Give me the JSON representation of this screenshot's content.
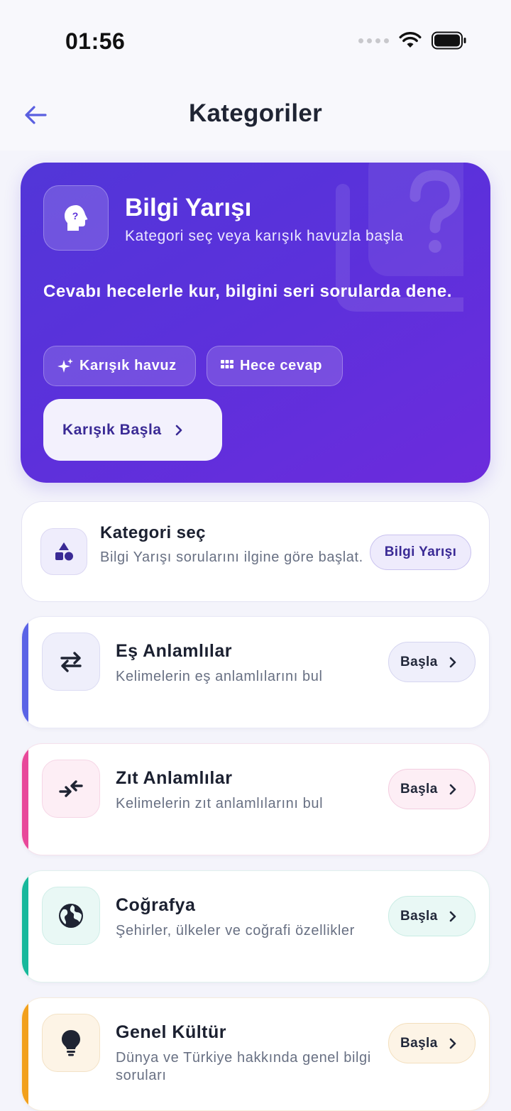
{
  "status_bar": {
    "time": "01:56"
  },
  "header": {
    "title": "Kategoriler"
  },
  "hero": {
    "title": "Bilgi Yarışı",
    "subtitle": "Kategori seç veya karışık havuzla başla",
    "description": "Cevabı hecelerle kur, bilgini seri sorularda dene.",
    "chips": [
      "Karışık havuz",
      "Hece cevap"
    ],
    "start_label": "Karışık Başla"
  },
  "select": {
    "title": "Kategori seç",
    "description": "Bilgi Yarışı sorularını ilgine göre başlat.",
    "badge": "Bilgi Yarışı"
  },
  "categories": [
    {
      "title": "Eş Anlamlılar",
      "description": "Kelimelerin eş anlamlılarını bul",
      "button": "Başla",
      "accent": "#5a63e6",
      "icon": "swap-arrows-icon"
    },
    {
      "title": "Zıt Anlamlılar",
      "description": "Kelimelerin zıt anlamlılarını bul",
      "button": "Başla",
      "accent": "#e8489a",
      "icon": "opposite-arrows-icon"
    },
    {
      "title": "Coğrafya",
      "description": "Şehirler, ülkeler ve coğrafi özellikler",
      "button": "Başla",
      "accent": "#17b89c",
      "icon": "globe-icon"
    },
    {
      "title": "Genel Kültür",
      "description": "Dünya ve Türkiye hakkında genel bilgi soruları",
      "button": "Başla",
      "accent": "#f2a01c",
      "icon": "lightbulb-icon"
    }
  ],
  "colors": {
    "primary": "#5b31db",
    "background": "#f4f4fb"
  }
}
